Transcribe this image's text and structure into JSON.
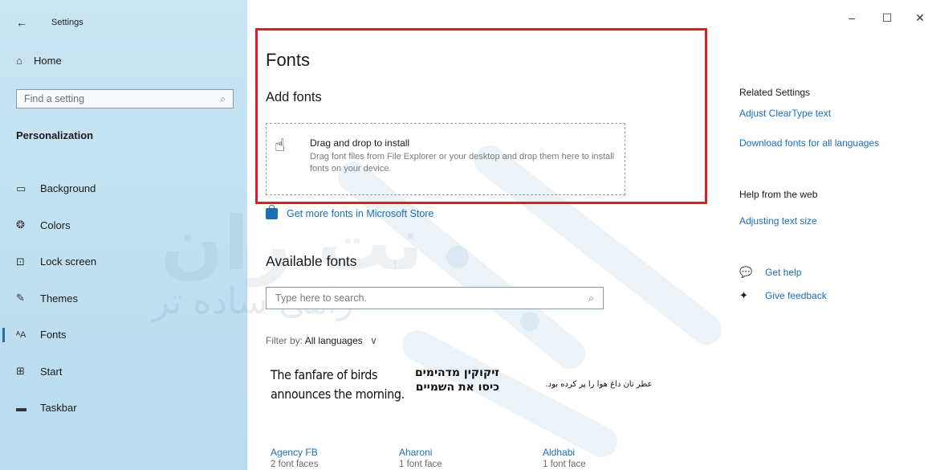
{
  "window": {
    "back_icon": "back-arrow-icon",
    "title": "Settings",
    "controls": [
      "minimize-icon",
      "maximize-icon",
      "close-icon"
    ]
  },
  "sidebar": {
    "home_label": "Home",
    "search_placeholder": "Find a setting",
    "section_title": "Personalization",
    "items": [
      {
        "label": "Background",
        "icon": "background-icon"
      },
      {
        "label": "Colors",
        "icon": "palette-icon"
      },
      {
        "label": "Lock screen",
        "icon": "lock-screen-icon"
      },
      {
        "label": "Themes",
        "icon": "themes-icon"
      },
      {
        "label": "Fonts",
        "icon": "fonts-icon",
        "active": true
      },
      {
        "label": "Start",
        "icon": "start-icon"
      },
      {
        "label": "Taskbar",
        "icon": "taskbar-icon"
      }
    ]
  },
  "main": {
    "title": "Fonts",
    "add_fonts_heading": "Add fonts",
    "dropzone": {
      "title": "Drag and drop to install",
      "description": "Drag font files from File Explorer or your desktop and drop them here to install fonts on your device."
    },
    "store_link": "Get more fonts in Microsoft Store",
    "available_heading": "Available fonts",
    "search_placeholder": "Type here to search.",
    "filter_label": "Filter by:",
    "filter_value": "All languages",
    "fonts": [
      {
        "sample": "The fanfare of birds announces the morning.",
        "name": "Agency FB",
        "faces": "2 font faces"
      },
      {
        "sample": "זיקוקין מדהימים כיסו את השמיים",
        "name": "Aharoni",
        "faces": "1 font face"
      },
      {
        "sample": "عطر نان داغ هوا را پر کرده بود.",
        "name": "Aldhabi",
        "faces": "1 font face"
      }
    ]
  },
  "related": {
    "heading": "Related Settings",
    "links": [
      "Adjust ClearType text",
      "Download fonts for all languages"
    ],
    "help_heading": "Help from the web",
    "help_links": [
      "Adjusting text size"
    ],
    "get_help": "Get help",
    "give_feedback": "Give feedback"
  },
  "watermark": {
    "text": "راهی ساده تر",
    "logo_text": "نت ران"
  },
  "colors": {
    "accent": "#1a6fb5",
    "sidebar_bg": "#c9e4f3",
    "highlight_border": "#d6202a"
  }
}
